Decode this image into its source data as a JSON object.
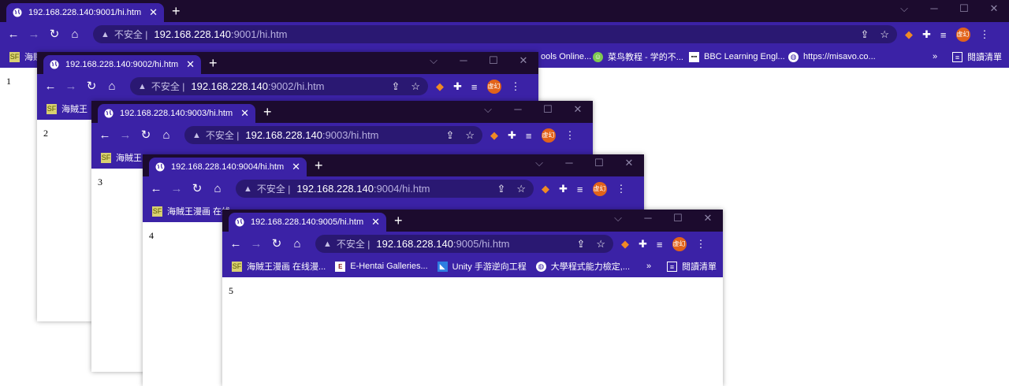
{
  "insecure_label": "不安全",
  "windows": [
    {
      "tab_title": "192.168.228.140:9001/hi.htm",
      "url_host": "192.168.228.140",
      "url_path": ":9001/hi.htm",
      "avatar_text": "虚幻",
      "bookmarks": [
        "海贼",
        "ools Online...",
        "菜鸟教程 - 学的不...",
        "BBC Learning Engl...",
        "https://misavo.co...",
        "閱讀清單"
      ],
      "content_text": "1"
    },
    {
      "tab_title": "192.168.228.140:9002/hi.htm",
      "url_host": "192.168.228.140",
      "url_path": ":9002/hi.htm",
      "avatar_text": "虚幻",
      "bookmarks": [
        "海賊王"
      ],
      "content_text": "2"
    },
    {
      "tab_title": "192.168.228.140:9003/hi.htm",
      "url_host": "192.168.228.140",
      "url_path": ":9003/hi.htm",
      "avatar_text": "虚幻",
      "bookmarks": [
        "海賊王"
      ],
      "content_text": "3"
    },
    {
      "tab_title": "192.168.228.140:9004/hi.htm",
      "url_host": "192.168.228.140",
      "url_path": ":9004/hi.htm",
      "avatar_text": "虚幻",
      "bookmarks": [
        "海賊王漫画 在线"
      ],
      "content_text": "4"
    },
    {
      "tab_title": "192.168.228.140:9005/hi.htm",
      "url_host": "192.168.228.140",
      "url_path": ":9005/hi.htm",
      "avatar_text": "虚幻",
      "bookmarks": [
        "海賊王漫画 在线漫...",
        "E-Hentai Galleries...",
        "Unity 手游逆向工程",
        "大學程式能力檢定,...",
        "閱讀清單"
      ],
      "content_text": "5"
    }
  ],
  "colors": {
    "tabstrip": "#1c0b2e",
    "toolbar": "#3b22a6",
    "omnibox": "#2a1872",
    "avatar": "#e2631a"
  }
}
